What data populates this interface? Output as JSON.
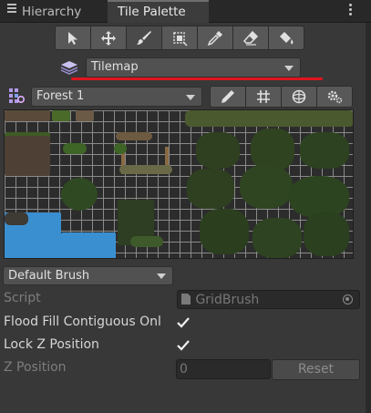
{
  "tabs": [
    {
      "label": "Hierarchy",
      "icon": "hierarchy-icon"
    },
    {
      "label": "Tile Palette",
      "icon": ""
    }
  ],
  "tools": [
    {
      "name": "select-tool",
      "icon": "arrow-icon"
    },
    {
      "name": "move-tool",
      "icon": "move-icon"
    },
    {
      "name": "paint-tool",
      "icon": "brush-icon",
      "active": true
    },
    {
      "name": "box-fill-tool",
      "icon": "box-icon"
    },
    {
      "name": "pick-tool",
      "icon": "eyedropper-icon"
    },
    {
      "name": "erase-tool",
      "icon": "eraser-icon"
    },
    {
      "name": "fill-tool",
      "icon": "paint-bucket-icon"
    }
  ],
  "target": {
    "label": "Tilemap",
    "icon": "layers-icon"
  },
  "palette": {
    "label": "Forest 1",
    "icon": "palette-grid-icon"
  },
  "palette_tools": [
    "edit-pencil-icon",
    "grid-icon",
    "gizmo-icon",
    "settings-icon"
  ],
  "brush": {
    "label": "Default Brush"
  },
  "properties": {
    "script_label": "Script",
    "script_value": "GridBrush",
    "flood_label": "Flood Fill Contiguous Onl",
    "flood_checked": true,
    "lockz_label": "Lock Z Position",
    "lockz_checked": true,
    "zpos_label": "Z Position",
    "zpos_value": "0",
    "reset_label": "Reset"
  },
  "colors": {
    "highlight": "#e0141e",
    "water": "#3a8fd0",
    "foliage": "#3d5a2a"
  }
}
